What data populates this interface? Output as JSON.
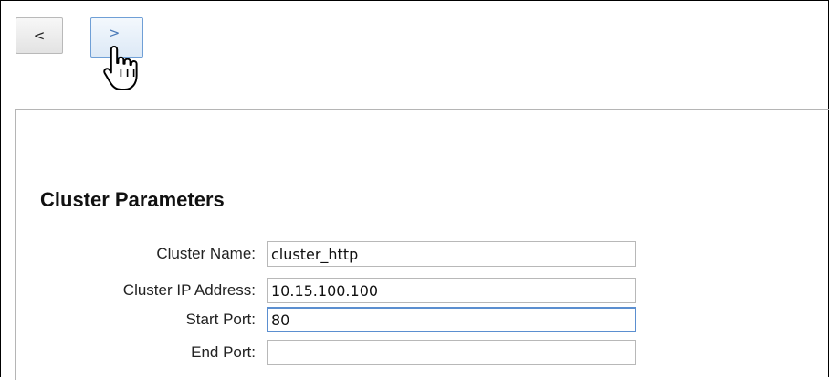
{
  "navigation": {
    "back_label": "<",
    "forward_label": ">"
  },
  "section": {
    "title": "Cluster Parameters"
  },
  "form": {
    "fields": [
      {
        "label": "Cluster Name:",
        "value": "cluster_http"
      },
      {
        "label": "Cluster IP Address:",
        "value": "10.15.100.100"
      },
      {
        "label": "Start Port:",
        "value": "80"
      },
      {
        "label": "End Port:",
        "value": ""
      }
    ]
  },
  "colors": {
    "focus_border": "#5b8fd0",
    "forward_button_border": "#6f9fd6",
    "input_border": "#b8b8b8"
  },
  "icons": {
    "cursor": "hand-pointer-icon"
  }
}
